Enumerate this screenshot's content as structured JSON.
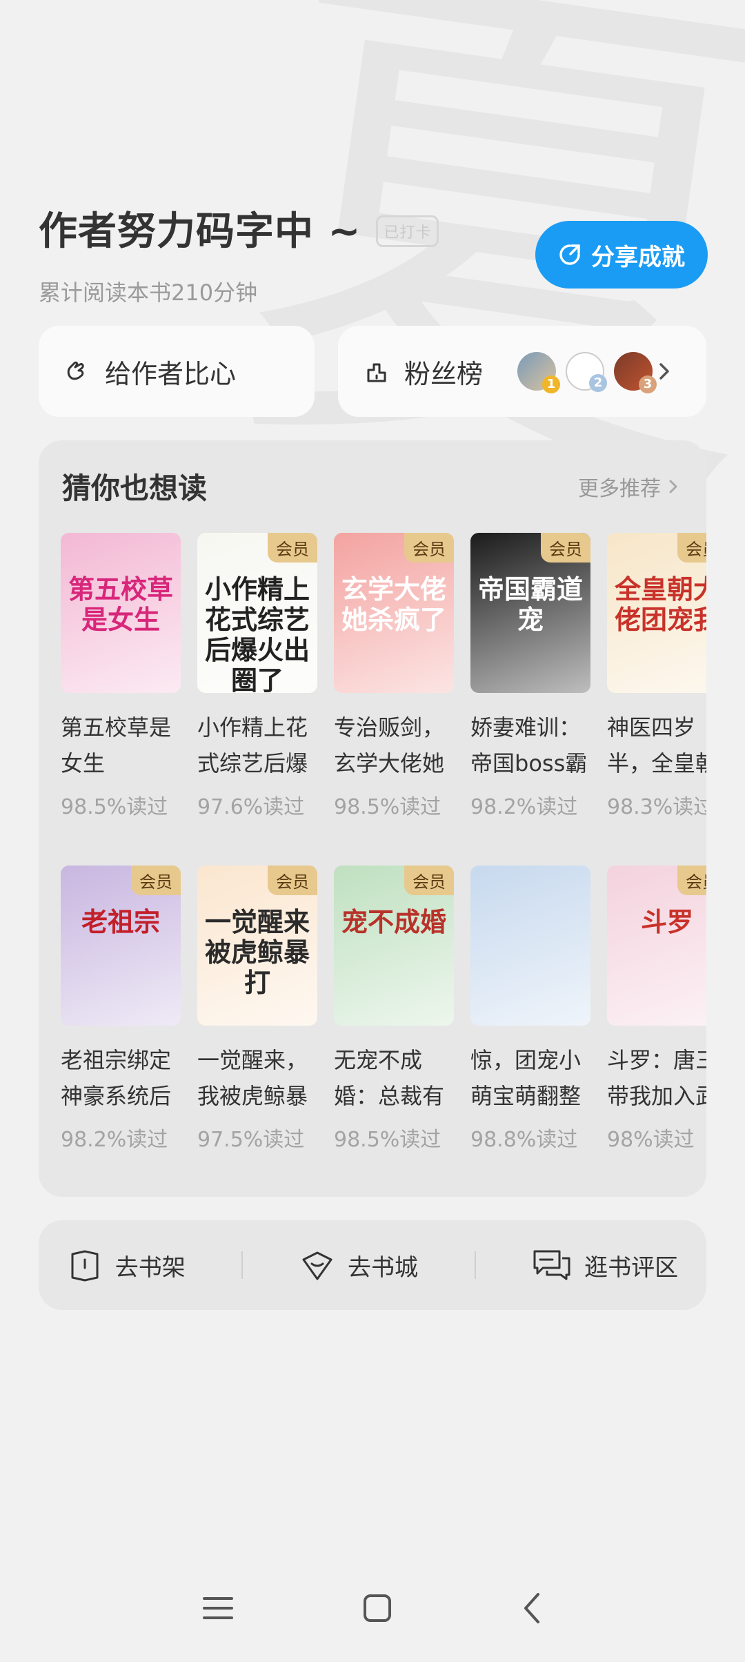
{
  "header": {
    "title": "作者努力码字中 ~",
    "stamp": "已打卡",
    "subtitle": "累计阅读本书210分钟",
    "share_label": "分享成就"
  },
  "actions": {
    "heart_label": "给作者比心",
    "fans_label": "粉丝榜",
    "fans_ranks": [
      "1",
      "2",
      "3"
    ]
  },
  "recommend": {
    "title": "猜你也想读",
    "more_label": "更多推荐",
    "row1": [
      {
        "cover": "第五校草是女生",
        "name1": "第五校草是",
        "name2": "女生",
        "read": "98.5%读过",
        "vip": "",
        "bg": "#f3b8d4",
        "fg": "#d8267a"
      },
      {
        "cover": "小作精上花式综艺后爆火出圈了",
        "name1": "小作精上花",
        "name2": "式综艺后爆",
        "read": "97.6%读过",
        "vip": "会员",
        "bg": "#f7f7f2",
        "fg": "#222222"
      },
      {
        "cover": "玄学大佬她杀疯了",
        "name1": "专治贩剑，",
        "name2": "玄学大佬她",
        "read": "98.5%读过",
        "vip": "会员",
        "bg": "#f3a3a0",
        "fg": "#ffffff"
      },
      {
        "cover": "帝国霸道宠",
        "name1": "娇妻难训：",
        "name2": "帝国boss霸",
        "read": "98.2%读过",
        "vip": "会员",
        "bg": "#1b1b1b",
        "fg": "#ffffff"
      },
      {
        "cover": "全皇朝大佬团宠我",
        "name1": "神医四岁",
        "name2": "半，全皇朝",
        "read": "98.3%读过",
        "vip": "会员",
        "bg": "#f7e6c8",
        "fg": "#c8322a"
      }
    ],
    "row2": [
      {
        "cover": "老祖宗",
        "name1": "老祖宗绑定",
        "name2": "神豪系统后",
        "read": "98.2%读过",
        "vip": "会员",
        "bg": "#c8b6e0",
        "fg": "#c21f2a"
      },
      {
        "cover": "一觉醒来被虎鲸暴打",
        "name1": "一觉醒来，",
        "name2": "我被虎鲸暴",
        "read": "97.5%读过",
        "vip": "会员",
        "bg": "#fbe6cf",
        "fg": "#2b2b2b"
      },
      {
        "cover": "宠不成婚",
        "name1": "无宠不成",
        "name2": "婚：总裁有",
        "read": "98.5%读过",
        "vip": "会员",
        "bg": "#bfe0c0",
        "fg": "#b8322a"
      },
      {
        "cover": "",
        "name1": "惊，团宠小",
        "name2": "萌宝萌翻整",
        "read": "98.8%读过",
        "vip": "",
        "bg": "#c7d9ee",
        "fg": "#333333"
      },
      {
        "cover": "斗罗",
        "name1": "斗罗：唐三",
        "name2": "带我加入武",
        "read": "98%读过",
        "vip": "会员",
        "bg": "#f4d2dd",
        "fg": "#c8322a"
      }
    ]
  },
  "bottom_nav": {
    "shelf": "去书架",
    "store": "去书城",
    "comment": "逛书评区"
  },
  "colors": {
    "accent": "#1a9cf4",
    "vip_badge": "#e7c98e"
  }
}
